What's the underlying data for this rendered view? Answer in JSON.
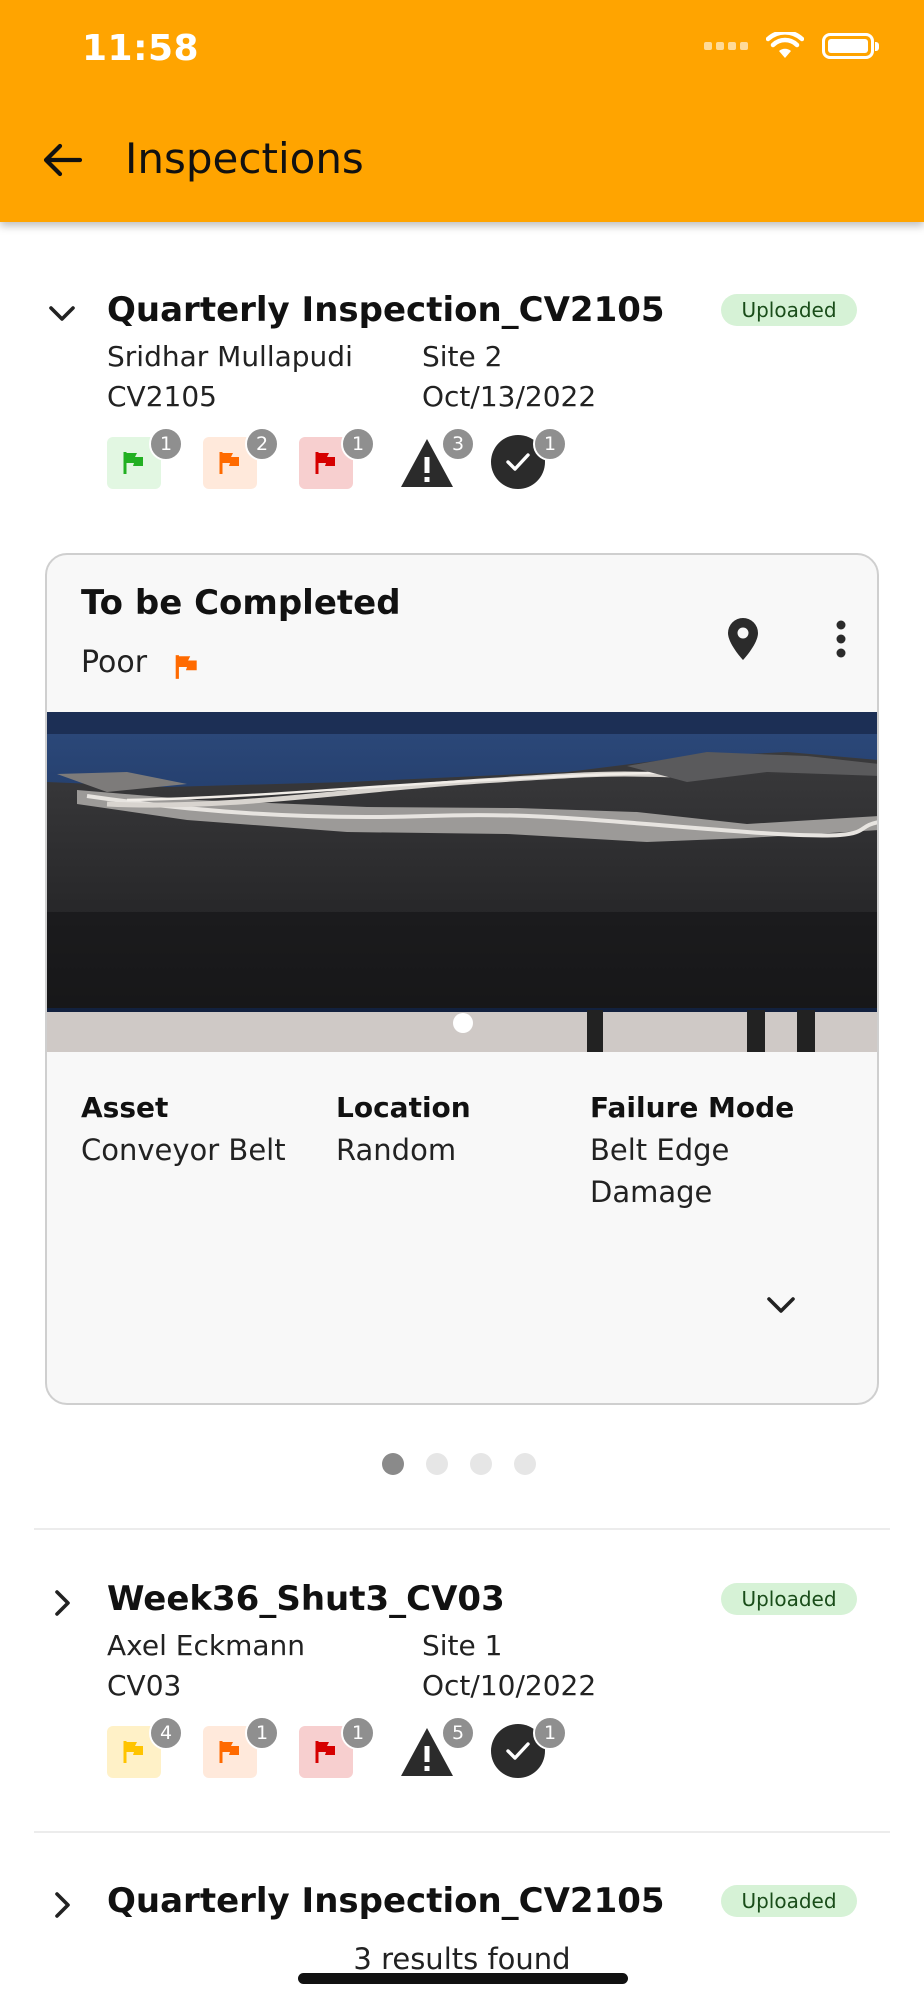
{
  "status_bar": {
    "time": "11:58"
  },
  "app_bar": {
    "title": "Inspections",
    "back_icon": "arrow-left-icon"
  },
  "colors": {
    "app_bar": "#FFA400",
    "uploaded_badge_bg": "#D6F2D6",
    "flag_green": "#22B022",
    "flag_orange": "#FF6A00",
    "flag_red": "#D60000",
    "flag_yellow": "#FFC400"
  },
  "inspections": [
    {
      "title": "Quarterly Inspection_CV2105",
      "status": "Uploaded",
      "inspector": "Sridhar Mullapudi",
      "site": "Site 2",
      "asset_code": "CV2105",
      "date": "Oct/13/2022",
      "expanded": true,
      "counts": {
        "good": "1",
        "poor": "2",
        "critical": "1",
        "warnings": "3",
        "completed": "1"
      }
    },
    {
      "title": "Week36_Shut3_CV03",
      "status": "Uploaded",
      "inspector": "Axel Eckmann",
      "site": "Site 1",
      "asset_code": "CV03",
      "date": "Oct/10/2022",
      "expanded": false,
      "counts": {
        "fair": "4",
        "poor": "1",
        "critical": "1",
        "warnings": "5",
        "completed": "1"
      }
    },
    {
      "title": "Quarterly Inspection_CV2105",
      "status": "Uploaded",
      "expanded": false
    }
  ],
  "finding_card": {
    "title": "To be Completed",
    "rating": "Poor",
    "fields": [
      {
        "label": "Asset",
        "value": "Conveyor Belt"
      },
      {
        "label": "Location",
        "value": "Random"
      },
      {
        "label": "Failure Mode",
        "value": "Belt Edge Damage"
      }
    ],
    "pager": {
      "total": 4,
      "active": 1
    }
  },
  "footer": {
    "results_text": "3 results found"
  }
}
